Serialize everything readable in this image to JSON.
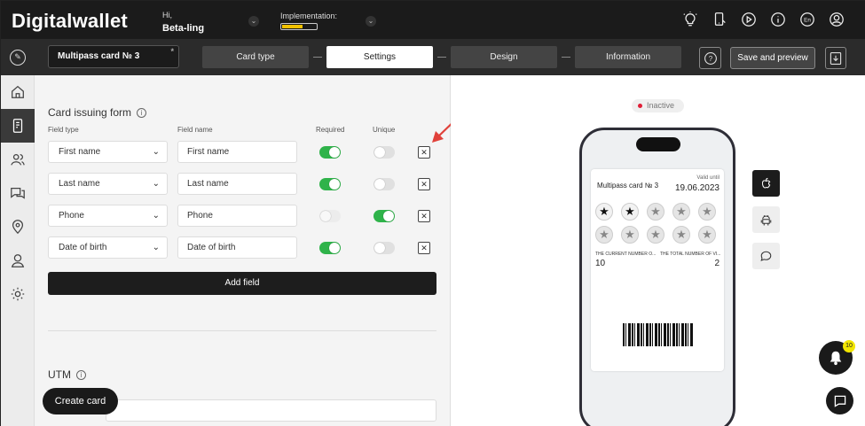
{
  "header": {
    "logo": "Digitalwallet",
    "greeting": "Hi,",
    "user_name": "Beta-ling",
    "implementation_label": "Implementation:",
    "implementation_progress": 0.6,
    "language": "En",
    "icons": [
      "lightbulb-icon",
      "phone-icon",
      "play-icon",
      "info-icon",
      "language-icon",
      "profile-icon"
    ]
  },
  "stepbar": {
    "card_name": "Multipass card № 3",
    "card_name_marker": "*",
    "steps": [
      {
        "label": "Card type",
        "active": false
      },
      {
        "label": "Settings",
        "active": true
      },
      {
        "label": "Design",
        "active": false
      },
      {
        "label": "Information",
        "active": false
      }
    ],
    "help_label": "?",
    "save_label": "Save and preview"
  },
  "sidebar": {
    "items": [
      "home",
      "cards",
      "clients",
      "messages",
      "locations",
      "users",
      "settings"
    ],
    "active": "cards"
  },
  "form": {
    "title": "Card issuing form",
    "info_symbol": "i",
    "columns": {
      "field_type": "Field type",
      "field_name": "Field name",
      "required": "Required",
      "unique": "Unique"
    },
    "rows": [
      {
        "type": "First name",
        "name": "First name",
        "required": "on",
        "unique": "off"
      },
      {
        "type": "Last name",
        "name": "Last name",
        "required": "on",
        "unique": "off"
      },
      {
        "type": "Phone",
        "name": "Phone",
        "required": "disabled",
        "unique": "on"
      },
      {
        "type": "Date of birth",
        "name": "Date of birth",
        "required": "on",
        "unique": "off"
      }
    ],
    "add_field_label": "Add field",
    "utm_title": "UTM",
    "create_card_label": "Create card"
  },
  "preview": {
    "status": "Inactive",
    "pass": {
      "title": "Multipass card № 3",
      "valid_label": "Valid until",
      "valid_date": "19.06.2023",
      "stars_filled": 2,
      "stars_total": 10,
      "label_current": "THE CURRENT NUMBER O...",
      "label_total": "THE TOTAL NUMBER OF VI...",
      "value_current": "10",
      "value_total": "2"
    },
    "os_buttons": [
      "apple",
      "android",
      "chat"
    ],
    "notification_count": "10"
  },
  "colors": {
    "toggle_on": "#2fb34a",
    "status_dot": "#e01e37",
    "progress": "#f2c200",
    "annotation_arrow": "#e0413a"
  }
}
